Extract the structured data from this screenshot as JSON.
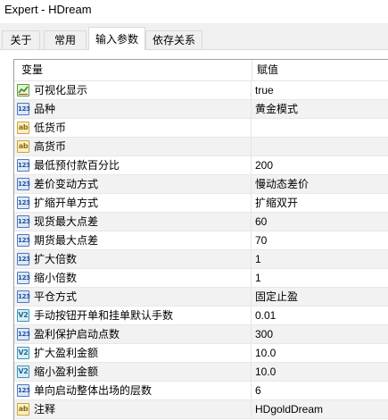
{
  "window": {
    "title": "Expert - HDream"
  },
  "tabs": [
    {
      "label": "关于",
      "active": false
    },
    {
      "label": "常用",
      "active": false
    },
    {
      "label": "输入参数",
      "active": true
    },
    {
      "label": "依存关系",
      "active": false
    }
  ],
  "grid": {
    "col_variable": "变量",
    "col_value": "赋值",
    "rows": [
      {
        "icon": "bool-icon",
        "label": "可视化显示",
        "value": "true"
      },
      {
        "icon": "int-icon",
        "label": "品种",
        "value": "黄金模式"
      },
      {
        "icon": "string-icon",
        "label": "低货币",
        "value": ""
      },
      {
        "icon": "string-icon",
        "label": "高货币",
        "value": ""
      },
      {
        "icon": "int-icon",
        "label": "最低预付款百分比",
        "value": "200"
      },
      {
        "icon": "int-icon",
        "label": "差价变动方式",
        "value": "慢动态差价"
      },
      {
        "icon": "int-icon",
        "label": "扩缩开单方式",
        "value": "扩缩双开"
      },
      {
        "icon": "int-icon",
        "label": "现货最大点差",
        "value": "60"
      },
      {
        "icon": "int-icon",
        "label": "期货最大点差",
        "value": "70"
      },
      {
        "icon": "int-icon",
        "label": "扩大倍数",
        "value": "1"
      },
      {
        "icon": "int-icon",
        "label": "缩小倍数",
        "value": "1"
      },
      {
        "icon": "int-icon",
        "label": "平仓方式",
        "value": "固定止盈"
      },
      {
        "icon": "double-icon",
        "label": "手动按钮开单和挂单默认手数",
        "value": "0.01"
      },
      {
        "icon": "int-icon",
        "label": "盈利保护启动点数",
        "value": "300"
      },
      {
        "icon": "double-icon",
        "label": "扩大盈利金额",
        "value": "10.0"
      },
      {
        "icon": "double-icon",
        "label": "缩小盈利金额",
        "value": "10.0"
      },
      {
        "icon": "int-icon",
        "label": "单向启动整体出场的层数",
        "value": "6"
      },
      {
        "icon": "string-icon",
        "label": "注释",
        "value": "HDgoldDream"
      }
    ]
  },
  "icon_glyphs": {
    "int": "123",
    "string": "ab",
    "double": "V2"
  },
  "colors": {
    "header_text": "#000000",
    "alt_row": "#f2f2f2",
    "grid_border": "#a0a0a0"
  }
}
